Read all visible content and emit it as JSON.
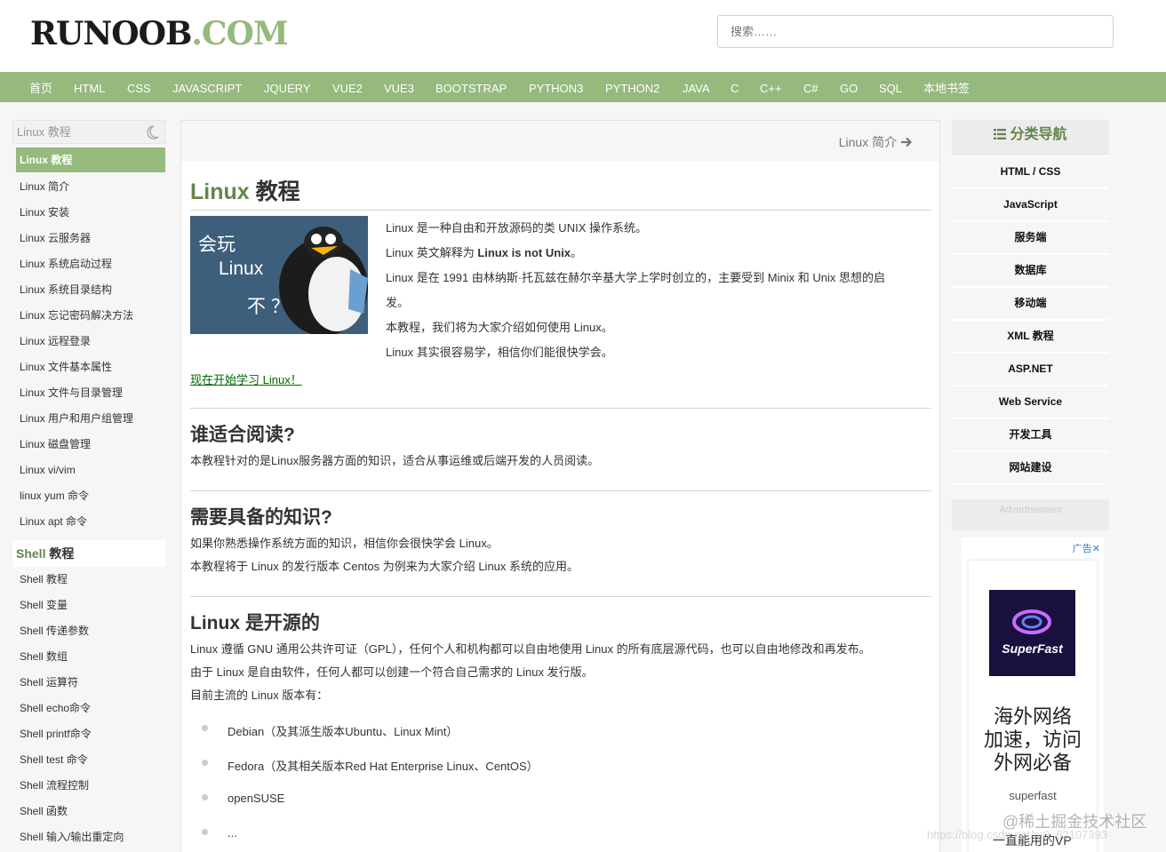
{
  "header": {
    "logo_main": "RUNOOB",
    "logo_dot": ".COM",
    "search_placeholder": "搜索……"
  },
  "nav": [
    "首页",
    "HTML",
    "CSS",
    "JAVASCRIPT",
    "JQUERY",
    "VUE2",
    "VUE3",
    "BOOTSTRAP",
    "PYTHON3",
    "PYTHON2",
    "JAVA",
    "C",
    "C++",
    "C#",
    "GO",
    "SQL",
    "本地书签"
  ],
  "left": {
    "search_placeholder": "Linux 教程",
    "linux_items": [
      "Linux 教程",
      "Linux 简介",
      "Linux 安装",
      "Linux 云服务器",
      "Linux 系统启动过程",
      "Linux 系统目录结构",
      "Linux 忘记密码解决方法",
      "Linux 远程登录",
      "Linux 文件基本属性",
      "Linux 文件与目录管理",
      "Linux 用户和用户组管理",
      "Linux 磁盘管理",
      "Linux vi/vim",
      "linux yum 命令",
      "Linux apt 命令"
    ],
    "shell_section_en": "Shell",
    "shell_section_cn": " 教程",
    "shell_items": [
      "Shell 教程",
      "Shell 变量",
      "Shell 传递参数",
      "Shell 数组",
      "Shell 运算符",
      "Shell echo命令",
      "Shell printf命令",
      "Shell test 命令",
      "Shell 流程控制",
      "Shell 函数",
      "Shell 输入/输出重定向"
    ]
  },
  "main": {
    "next_link": "Linux 简介",
    "title_en": "Linux",
    "title_cn": " 教程",
    "hero": {
      "t1": "会玩",
      "t2": "Linux",
      "t3": "不 ？"
    },
    "intro": {
      "p1": "Linux 是一种自由和开放源码的类 UNIX 操作系统。",
      "p2_pre": "Linux 英文解释为 ",
      "p2_bold": "Linux is not Unix",
      "p2_post": "。",
      "p3a": "Linux 是在 1991 由林纳斯·托瓦兹在赫尔辛基大学上学时创立的，主要受到 Minix 和 Unix 思想的启",
      "p3b": "发。",
      "p4": "本教程，我们将为大家介绍如何使用 Linux。",
      "p5": "Linux 其实很容易学，相信你们能很快学会。"
    },
    "start_link": "现在开始学习 Linux！",
    "s1_title": "谁适合阅读?",
    "s1_text": "本教程针对的是Linux服务器方面的知识，适合从事运维或后端开发的人员阅读。",
    "s2_title": "需要具备的知识?",
    "s2_text1": "如果你熟悉操作系统方面的知识，相信你会很快学会 Linux。",
    "s2_text2": "本教程将于 Linux 的发行版本 Centos 为例来为大家介绍 Linux 系统的应用。",
    "s3_title": "Linux 是开源的",
    "s3_text1": "Linux 遵循 GNU 通用公共许可证（GPL），任何个人和机构都可以自由地使用 Linux 的所有底层源代码，也可以自由地修改和再发布。",
    "s3_text2": "由于 Linux 是自由软件，任何人都可以创建一个符合自己需求的 Linux 发行版。",
    "s3_text3": "目前主流的 Linux 版本有：",
    "distros": [
      "Debian（及其派生版本Ubuntu、Linux Mint）",
      "Fedora（及其相关版本Red Hat Enterprise Linux、CentOS）",
      "openSUSE",
      "..."
    ]
  },
  "right": {
    "title": "分类导航",
    "items": [
      "HTML / CSS",
      "JavaScript",
      "服务端",
      "数据库",
      "移动端",
      "XML 教程",
      "ASP.NET",
      "Web Service",
      "开发工具",
      "网站建设"
    ],
    "adv_label": "Advertisement",
    "ad_badge": "广告✕",
    "ad_logo": "SuperFast",
    "ad_big": "海外网络\n加速，访问\n外网必备",
    "ad_small": "superfast",
    "ad_bottom": "一直能用的VP"
  },
  "watermark": {
    "w1": "@稀土掘金技术社区",
    "w2": "https://blog.csdn.net/m0_62107393"
  },
  "colors": {
    "accent": "#96b97d",
    "accent_dark": "#64854c",
    "link": "#006600"
  }
}
